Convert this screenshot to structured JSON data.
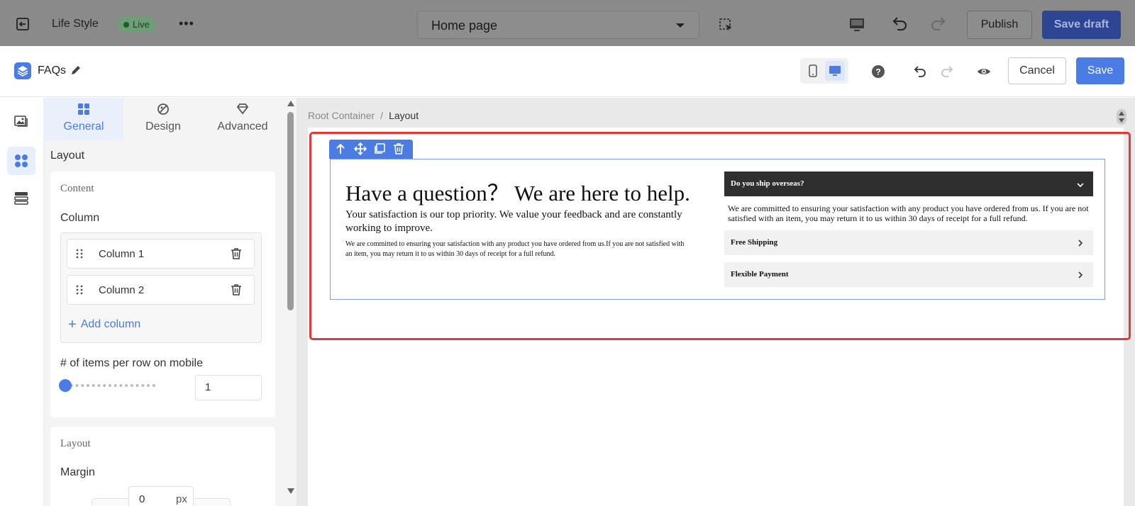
{
  "topbar": {
    "site_name": "Life Style",
    "live_badge": "Live",
    "more": "•••",
    "page_selector": "Home page",
    "publish_label": "Publish",
    "save_draft_label": "Save draft"
  },
  "editor": {
    "title": "FAQs",
    "cancel_label": "Cancel",
    "save_label": "Save",
    "accent_color": "#4a7ce3"
  },
  "panel": {
    "tabs": [
      {
        "label": "General",
        "icon": "grid-icon",
        "active": true
      },
      {
        "label": "Design",
        "icon": "palette-icon",
        "active": false
      },
      {
        "label": "Advanced",
        "icon": "diamond-icon",
        "active": false
      }
    ],
    "section_title": "Layout",
    "content_card": {
      "title": "Content",
      "column_label": "Column",
      "columns": [
        {
          "name": "Column 1"
        },
        {
          "name": "Column 2"
        }
      ],
      "add_column_label": "Add column",
      "items_per_row_label": "# of items per row on mobile",
      "items_per_row_value": "1",
      "slider_value_fraction": 0
    },
    "layout_card": {
      "title": "Layout",
      "margin_label": "Margin",
      "margin_value": "0",
      "margin_unit": "px"
    }
  },
  "canvas": {
    "breadcrumb": {
      "root": "Root Container",
      "separator": "/",
      "current": "Layout"
    },
    "faq_section": {
      "heading": "Have a question？ We are here to help.",
      "subheading": "Your satisfaction is our top priority. We value your feedback and are constantly working to improve.",
      "body": "We are committed to ensuring your satisfaction with any product you have ordered from us.If you are not satisfied with an item, you may return it to us within 30 days of receipt for a full refund.",
      "questions": [
        {
          "question": "Do you ship overseas?",
          "expanded": true,
          "answer": "We are committed to ensuring your satisfaction with any product you have ordered from us. If you are not satisfied with an item, you may return it to us within 30 days of receipt for a full refund."
        },
        {
          "question": "Free Shipping",
          "expanded": false
        },
        {
          "question": "Flexible Payment",
          "expanded": false
        }
      ]
    }
  }
}
